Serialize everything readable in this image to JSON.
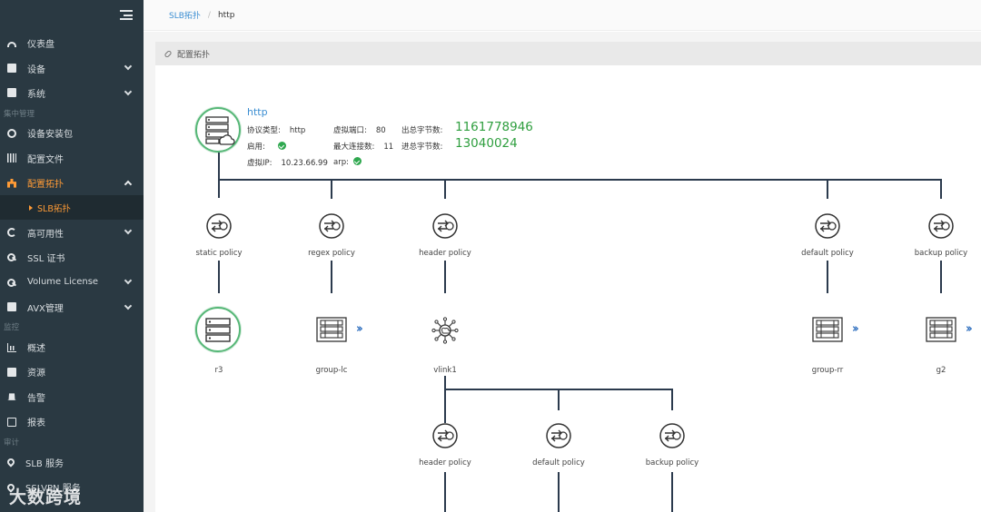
{
  "sidebar": {
    "watermark": "大数跨境",
    "items": [
      {
        "label": "仪表盘"
      },
      {
        "label": "设备"
      },
      {
        "label": "系统"
      },
      {
        "label": "设备安装包"
      },
      {
        "label": "配置文件"
      },
      {
        "label": "配置拓扑"
      },
      {
        "label": "高可用性"
      },
      {
        "label": "SSL 证书"
      },
      {
        "label": "Volume License"
      },
      {
        "label": "AVX管理"
      },
      {
        "label": "概述"
      },
      {
        "label": "资源"
      },
      {
        "label": "告警"
      },
      {
        "label": "报表"
      },
      {
        "label": "SLB 服务"
      },
      {
        "label": "SSLVPN 服务"
      }
    ],
    "sections": [
      "集中管理",
      "监控",
      "审计"
    ],
    "sub_item": "SLB拓扑"
  },
  "breadcrumb": {
    "root": "SLB拓扑",
    "current": "http"
  },
  "panel": {
    "title": "配置拓扑"
  },
  "vs": {
    "name": "http",
    "protocol_label": "协议类型:",
    "protocol_value": "http",
    "port_label": "虚拟端口:",
    "port_value": "80",
    "out_bytes_label": "出总字节数:",
    "out_bytes_value": "1161778946",
    "enabled_label": "启用:",
    "max_conn_label": "最大连接数:",
    "max_conn_value": "11",
    "in_bytes_label": "进总字节数:",
    "in_bytes_value": "13040024",
    "vip_label": "虚拟IP:",
    "vip_value": "10.23.66.99",
    "arp_label": "arp:"
  },
  "policies_top": [
    "static policy",
    "regex policy",
    "header policy",
    "default policy",
    "backup policy"
  ],
  "targets_top": [
    "r3",
    "group-lc",
    "vlink1",
    "group-rr",
    "g2"
  ],
  "policies_bottom": [
    "header policy",
    "default policy",
    "backup policy"
  ],
  "colors": {
    "sidebar_bg": "#2a3942",
    "accent": "#ff9b36",
    "link": "#3b8ed2",
    "success": "#2fa84f",
    "line": "#2b3a4d"
  }
}
